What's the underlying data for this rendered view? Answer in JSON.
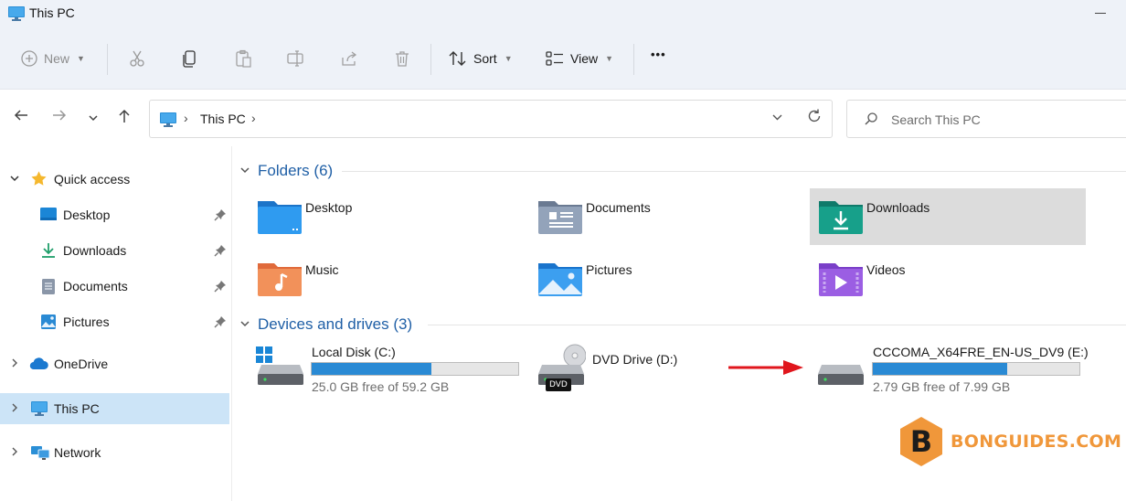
{
  "window": {
    "title": "This PC",
    "icon": "monitor-icon"
  },
  "toolbar": {
    "new_label": "New",
    "sort_label": "Sort",
    "view_label": "View",
    "more_label": "•••"
  },
  "address": {
    "crumb": "This PC",
    "separator": "›",
    "search_placeholder": "Search This PC"
  },
  "sidebar": {
    "items": [
      {
        "label": "Quick access",
        "icon": "star-icon"
      },
      {
        "label": "Desktop",
        "icon": "desktop-icon",
        "pinned": true
      },
      {
        "label": "Downloads",
        "icon": "download-icon",
        "pinned": true
      },
      {
        "label": "Documents",
        "icon": "document-icon",
        "pinned": true
      },
      {
        "label": "Pictures",
        "icon": "pictures-icon",
        "pinned": true
      },
      {
        "label": "OneDrive",
        "icon": "cloud-icon"
      },
      {
        "label": "This PC",
        "icon": "monitor-icon",
        "selected": true
      },
      {
        "label": "Network",
        "icon": "network-icon"
      }
    ]
  },
  "folders": {
    "header": "Folders (6)",
    "items": [
      {
        "name": "Desktop",
        "icon": "desktop-folder-icon"
      },
      {
        "name": "Documents",
        "icon": "documents-folder-icon"
      },
      {
        "name": "Downloads",
        "icon": "downloads-folder-icon",
        "selected": true
      },
      {
        "name": "Music",
        "icon": "music-folder-icon"
      },
      {
        "name": "Pictures",
        "icon": "pictures-folder-icon"
      },
      {
        "name": "Videos",
        "icon": "videos-folder-icon"
      }
    ]
  },
  "drives": {
    "header": "Devices and drives (3)",
    "items": [
      {
        "name": "Local Disk (C:)",
        "free_text": "25.0 GB free of 59.2 GB",
        "used_fraction": 0.58,
        "icon": "windows-drive-icon"
      },
      {
        "name": "DVD Drive (D:)",
        "icon": "dvd-drive-icon",
        "badge": "DVD"
      },
      {
        "name": "CCCOMA_X64FRE_EN-US_DV9 (E:)",
        "free_text": "2.79 GB free of 7.99 GB",
        "used_fraction": 0.65,
        "icon": "usb-drive-icon"
      }
    ]
  },
  "watermark": {
    "letter": "B",
    "text": "BONGUIDES.COM"
  },
  "colors": {
    "accent": "#2a8ad4",
    "header_blue": "#1f5fa6",
    "selection": "#cce4f7",
    "arrow_red": "#e0161d",
    "watermark_orange": "#f0973a"
  }
}
